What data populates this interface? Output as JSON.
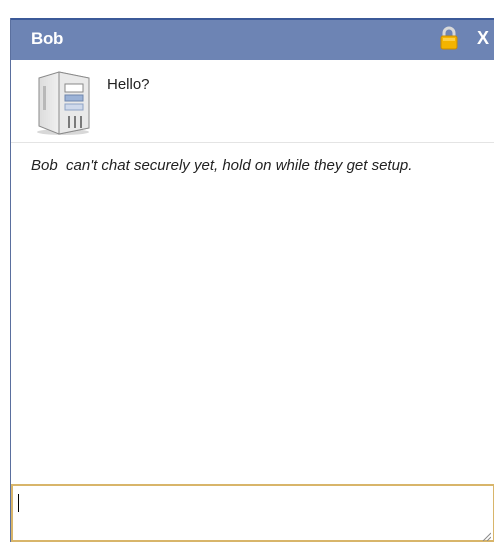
{
  "window": {
    "title": "Bob",
    "close_label": "X",
    "lock_icon": "lock-icon",
    "colors": {
      "titlebar": "#6d84b4",
      "titlebar_border": "#3b5998",
      "composer_border": "#d8b56a"
    }
  },
  "messages": [
    {
      "avatar": "server-computer-icon",
      "text": "Hello?"
    }
  ],
  "status": {
    "name": "Bob",
    "message": "can't chat securely yet, hold on while they get setup."
  },
  "composer": {
    "value": "",
    "placeholder": ""
  }
}
